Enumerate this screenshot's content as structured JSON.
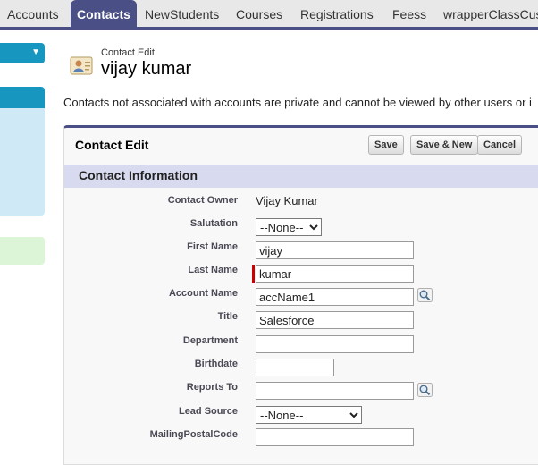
{
  "tabs": [
    "Accounts",
    "Contacts",
    "NewStudents",
    "Courses",
    "Registrations",
    "Feess",
    "wrapperClassCus"
  ],
  "page": {
    "subtitle": "Contact Edit",
    "title": "vijay kumar",
    "notice": "Contacts not associated with accounts are private and cannot be viewed by other users or i"
  },
  "block": {
    "title": "Contact Edit",
    "buttons": {
      "save": "Save",
      "save_new": "Save & New",
      "cancel": "Cancel"
    }
  },
  "section": {
    "title": "Contact Information"
  },
  "fields": {
    "contact_owner": {
      "label": "Contact Owner",
      "value": "Vijay Kumar"
    },
    "salutation": {
      "label": "Salutation",
      "value": "--None--"
    },
    "first_name": {
      "label": "First Name",
      "value": "vijay"
    },
    "last_name": {
      "label": "Last Name",
      "value": "kumar"
    },
    "account_name": {
      "label": "Account Name",
      "value": "accName1"
    },
    "title": {
      "label": "Title",
      "value": "Salesforce"
    },
    "department": {
      "label": "Department",
      "value": ""
    },
    "birthdate": {
      "label": "Birthdate",
      "value": ""
    },
    "reports_to": {
      "label": "Reports To",
      "value": ""
    },
    "lead_source": {
      "label": "Lead Source",
      "value": "--None--"
    },
    "mailing_postal_code": {
      "label": "MailingPostalCode",
      "value": ""
    }
  },
  "icons": {
    "lookup": "magnifier-lookup-icon",
    "contact": "contact-card-icon",
    "dropdown": "chevron-down-icon"
  },
  "colors": {
    "tab_active": "#4a4f86",
    "sidebar_blue": "#1797c0",
    "section_bg": "#d8daf0",
    "required": "#cc0000"
  }
}
